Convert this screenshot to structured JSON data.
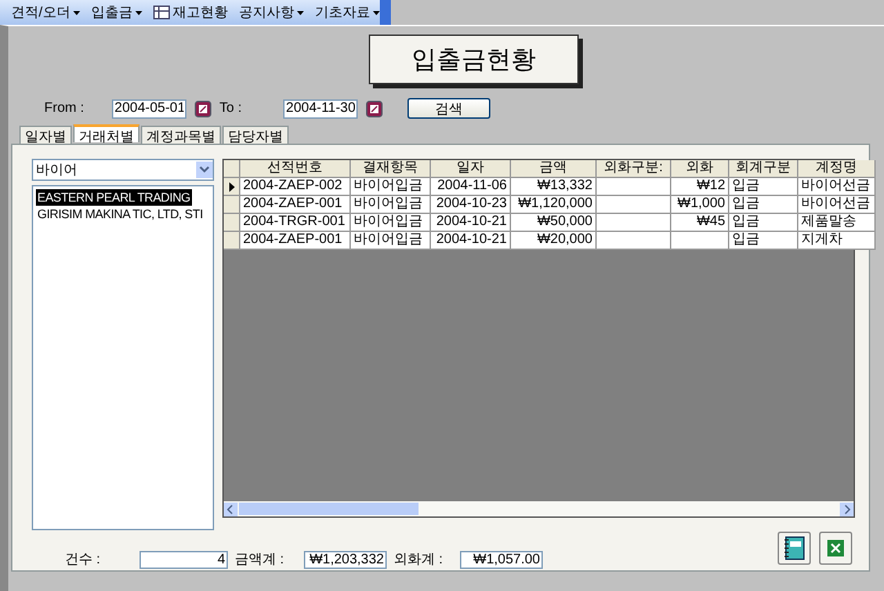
{
  "menu": [
    {
      "label": "견적/오더",
      "dropdown": true,
      "icon": false
    },
    {
      "label": "입출금",
      "dropdown": true,
      "icon": false
    },
    {
      "label": "재고현황",
      "dropdown": false,
      "icon": true
    },
    {
      "label": "공지사항",
      "dropdown": true,
      "icon": false
    },
    {
      "label": "기초자료",
      "dropdown": true,
      "icon": false
    }
  ],
  "title": "입출금현황",
  "filter": {
    "from_label": "From :",
    "from": "2004-05-01",
    "to_label": "To :",
    "to": "2004-11-30",
    "search_button": "검색"
  },
  "tabs": [
    {
      "label": "일자별",
      "selected": false
    },
    {
      "label": "거래처별",
      "selected": true
    },
    {
      "label": "계정과목별",
      "selected": false
    },
    {
      "label": "담당자별",
      "selected": false
    }
  ],
  "category_select": {
    "value": "바이어"
  },
  "clients": [
    {
      "name": "EASTERN PEARL TRADING",
      "selected": true
    },
    {
      "name": "GIRISIM MAKINA TIC, LTD, STI",
      "selected": false
    }
  ],
  "table": {
    "columns": [
      "선적번호",
      "결재항목",
      "일자",
      "금액",
      "외화구분:",
      "외화",
      "회계구분",
      "계정명"
    ],
    "rows": [
      {
        "current": true,
        "cells": [
          "2004-ZAEP-002",
          "바이어입금",
          "2004-11-06",
          "₩13,332",
          "",
          "₩12",
          "입금",
          "바이어선금"
        ]
      },
      {
        "current": false,
        "cells": [
          "2004-ZAEP-001",
          "바이어입금",
          "2004-10-23",
          "₩1,120,000",
          "",
          "₩1,000",
          "입금",
          "바이어선금"
        ]
      },
      {
        "current": false,
        "cells": [
          "2004-TRGR-001",
          "바이어입금",
          "2004-10-21",
          "₩50,000",
          "",
          "₩45",
          "입금",
          "제품말송"
        ]
      },
      {
        "current": false,
        "cells": [
          "2004-ZAEP-001",
          "바이어입금",
          "2004-10-21",
          "₩20,000",
          "",
          "",
          "입금",
          "지게차"
        ]
      }
    ]
  },
  "summary": {
    "count_label": "건수 :",
    "count": "4",
    "amount_label": "금액계 :",
    "amount": "₩1,203,332",
    "foreign_label": "외화계 :",
    "foreign": "₩1,057.00"
  }
}
